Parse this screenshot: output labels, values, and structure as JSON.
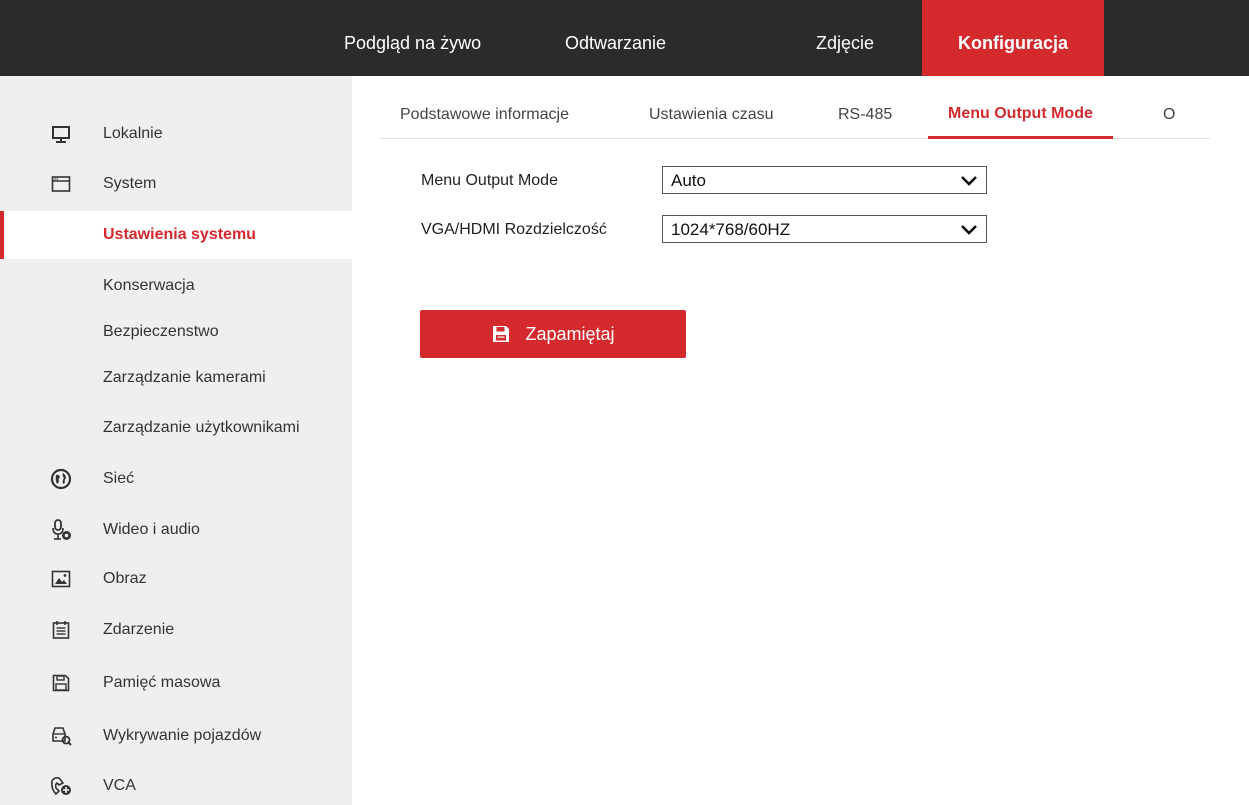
{
  "top_nav": {
    "items": [
      {
        "label": "Podgląd na żywo"
      },
      {
        "label": "Odtwarzanie"
      },
      {
        "label": "Zdjęcie"
      },
      {
        "label": "Konfiguracja",
        "active": true
      }
    ]
  },
  "sidebar": {
    "items": [
      {
        "label": "Lokalnie",
        "icon": "monitor-icon"
      },
      {
        "label": "System",
        "icon": "window-icon"
      },
      {
        "label": "Ustawienia systemu",
        "active": true
      },
      {
        "label": "Konserwacja"
      },
      {
        "label": "Bezpieczenstwo"
      },
      {
        "label": "Zarządzanie kamerami"
      },
      {
        "label": "Zarządzanie użytkownikami"
      },
      {
        "label": "Sieć",
        "icon": "globe-icon"
      },
      {
        "label": "Wideo i audio",
        "icon": "microphone-icon"
      },
      {
        "label": "Obraz",
        "icon": "image-icon"
      },
      {
        "label": "Zdarzenie",
        "icon": "calendar-icon"
      },
      {
        "label": "Pamięć masowa",
        "icon": "floppy-icon"
      },
      {
        "label": "Wykrywanie pojazdów",
        "icon": "vehicle-search-icon"
      },
      {
        "label": "VCA",
        "icon": "vca-icon"
      }
    ]
  },
  "tabs": [
    {
      "label": "Podstawowe informacje"
    },
    {
      "label": "Ustawienia czasu"
    },
    {
      "label": "RS-485"
    },
    {
      "label": "Menu Output Mode",
      "active": true
    },
    {
      "label": "O"
    }
  ],
  "form": {
    "output_mode": {
      "label": "Menu Output Mode",
      "value": "Auto"
    },
    "resolution": {
      "label": "VGA/HDMI Rozdzielczość",
      "value": "1024*768/60HZ"
    }
  },
  "save_button": {
    "label": "Zapamiętaj"
  },
  "colors": {
    "accent": "#d42a2e",
    "topbar": "#2b2b2b",
    "sidebar": "#efefef"
  }
}
